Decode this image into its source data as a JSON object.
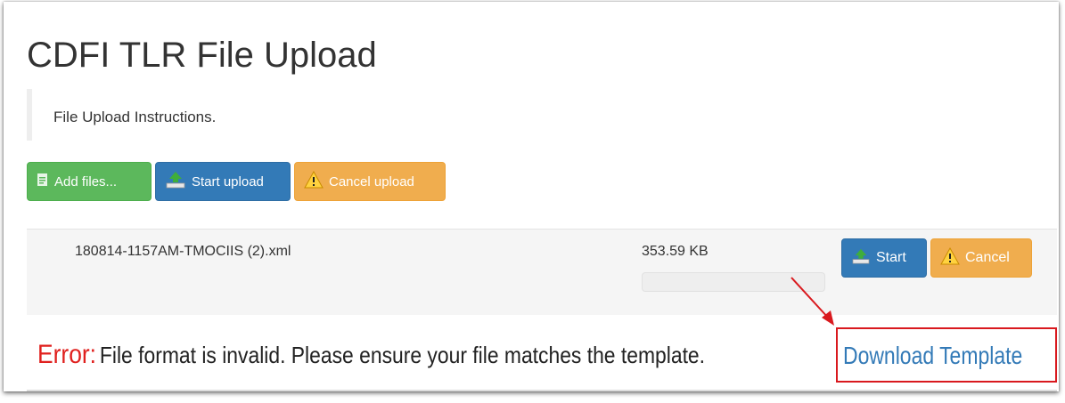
{
  "page": {
    "title": "CDFI TLR File Upload",
    "instructions": "File Upload Instructions."
  },
  "toolbar": {
    "add_files_label": "Add files...",
    "start_upload_label": "Start upload",
    "cancel_upload_label": "Cancel upload"
  },
  "file_row": {
    "file_name": "180814-1157AM-TMOCIIS (2).xml",
    "file_size": "353.59 KB",
    "progress_percent": 0,
    "start_label": "Start",
    "cancel_label": "Cancel"
  },
  "error": {
    "label": "Error:",
    "message": "File format is invalid. Please ensure your file matches the template.",
    "link_text": "Download Template"
  },
  "colors": {
    "success": "#5cb85c",
    "primary": "#337ab7",
    "warning": "#f0ad4e",
    "error": "#e0201e",
    "annotation": "#d9191e"
  }
}
